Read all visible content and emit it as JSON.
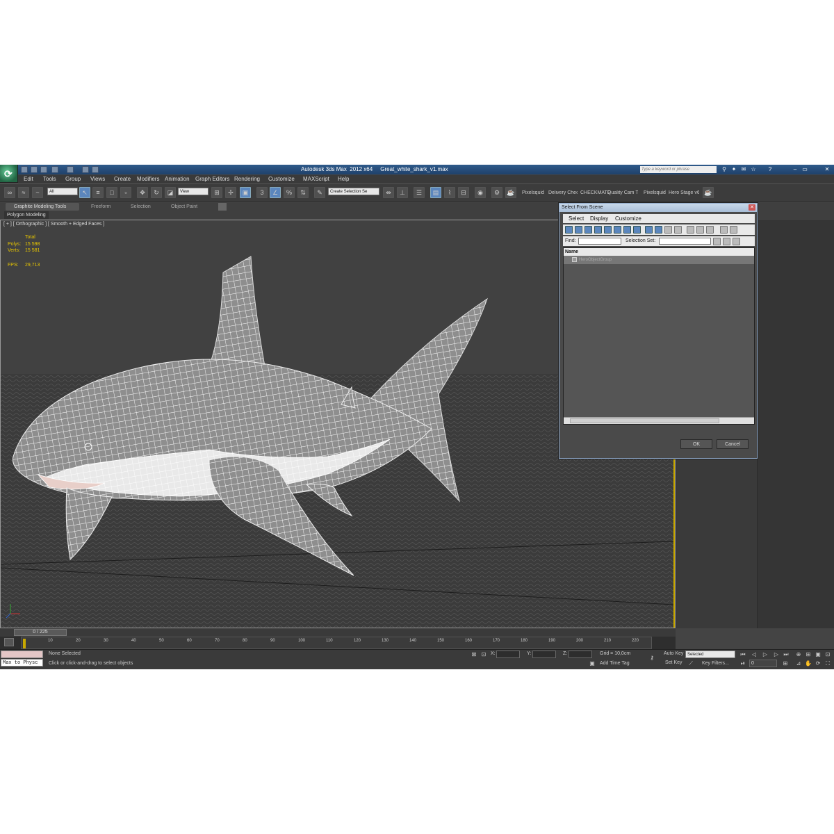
{
  "app": {
    "title": "Autodesk 3ds Max  2012 x64     Great_white_shark_v1.max",
    "search_placeholder": "Type a keyword or phrase",
    "window_controls": [
      "–",
      "▭",
      "✕"
    ]
  },
  "menu": [
    "Edit",
    "Tools",
    "Group",
    "Views",
    "Create",
    "Modifiers",
    "Animation",
    "Graph Editors",
    "Rendering",
    "Customize",
    "MAXScript",
    "Help"
  ],
  "toolbar": {
    "selection_filter": "All",
    "ref_coord": "View",
    "named_selection_placeholder": "Create Selection Se",
    "plugins": [
      "Pixelsquid",
      "Delivery Check",
      "CHECKMATE",
      "Quality Cam Tool",
      "Pixelsquid",
      "Hero Stage v6"
    ]
  },
  "ribbon": {
    "tabs": [
      "Graphite Modeling Tools",
      "Freeform",
      "Selection",
      "Object Paint"
    ],
    "panel": "Polygon Modeling"
  },
  "viewport": {
    "label": "[ + ] [ Orthographic ] [ Smooth + Edged Faces ]",
    "stats": {
      "total_label": "Total",
      "polys_label": "Polys:",
      "polys": "15 598",
      "verts_label": "Verts:",
      "verts": "15 581",
      "fps_label": "FPS:",
      "fps": "29,713"
    }
  },
  "dialog": {
    "title": "Select From Scene",
    "menu": [
      "Select",
      "Display",
      "Customize"
    ],
    "find_label": "Find:",
    "selection_set_label": "Selection Set:",
    "column_name": "Name",
    "rows": [
      "HeroObjectGroup"
    ],
    "ok": "OK",
    "cancel": "Cancel"
  },
  "timeline": {
    "frame": "0 / 225",
    "ticks": [
      "10",
      "20",
      "30",
      "40",
      "50",
      "60",
      "70",
      "80",
      "90",
      "100",
      "110",
      "120",
      "130",
      "140",
      "150",
      "160",
      "170",
      "180",
      "190",
      "200",
      "210",
      "220"
    ]
  },
  "status": {
    "maxscript": "Max to Physc",
    "selection": "None Selected",
    "prompt": "Click or click-and-drag to select objects",
    "x_label": "X:",
    "y_label": "Y:",
    "z_label": "Z:",
    "grid": "Grid = 10,0cm",
    "add_time_tag": "Add Time Tag",
    "auto_key": "Auto Key",
    "set_key": "Set Key",
    "key_mode": "Selected",
    "key_filters": "Key Filters...",
    "current_frame": "0"
  },
  "colors": {
    "accent": "#5b86bd",
    "stats": "#e8c600",
    "titlebar": "#2f5a8a"
  }
}
